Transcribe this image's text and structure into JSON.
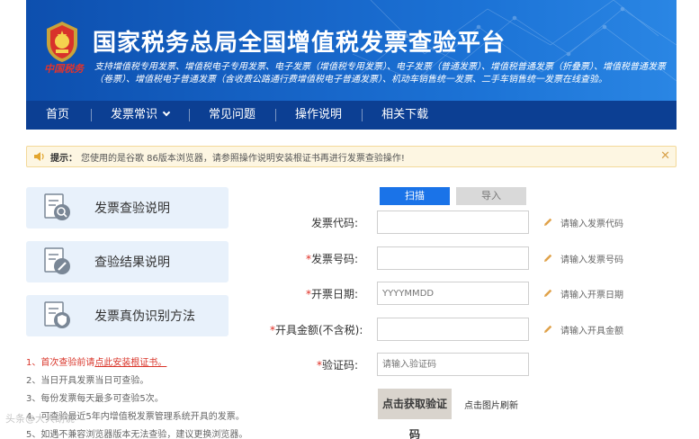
{
  "header": {
    "title": "国家税务总局全国增值税发票查验平台",
    "subtitle": "支持增值税专用发票、增值税电子专用发票、电子发票（增值税专用发票）、电子发票（普通发票）、增值税普通发票（折叠票）、增值税普通发票（卷票）、增值税电子普通发票（含收费公路通行费增值税电子普通发票）、机动车销售统一发票、二手车销售统一发票在线查验。",
    "seal_text": "中国税务"
  },
  "nav": {
    "items": [
      {
        "label": "首页"
      },
      {
        "label": "发票常识"
      },
      {
        "label": "常见问题"
      },
      {
        "label": "操作说明"
      },
      {
        "label": "相关下载"
      }
    ]
  },
  "notice": {
    "label": "提示：",
    "text": "您使用的是谷歌 86版本浏览器，请参照操作说明安装根证书再进行发票查验操作!",
    "close": "✕"
  },
  "sidebar": {
    "items": [
      {
        "label": "发票查验说明",
        "icon": "doc-search-icon"
      },
      {
        "label": "查验结果说明",
        "icon": "doc-edit-icon"
      },
      {
        "label": "发票真伪识别方法",
        "icon": "doc-shield-icon"
      }
    ]
  },
  "notes": {
    "n1_prefix": "1、首次查验前请",
    "n1_link": "点此安装根证书。",
    "n2": "2、当日开具发票当日可查验。",
    "n3": "3、每份发票每天最多可查验5次。",
    "n4": "4、可查验最近5年内增值税发票管理系统开具的发票。",
    "n5": "5、如遇不兼容浏览器版本无法查验，建议更换浏览器。"
  },
  "form": {
    "tabs": {
      "scan": "扫描",
      "import": "导入"
    },
    "fields": [
      {
        "label": "发票代码:",
        "required": false,
        "placeholder": "",
        "hint": "请输入发票代码"
      },
      {
        "label": "发票号码:",
        "required": true,
        "placeholder": "",
        "hint": "请输入发票号码"
      },
      {
        "label": "开票日期:",
        "required": true,
        "placeholder": "YYYYMMDD",
        "hint": "请输入开票日期"
      },
      {
        "label": "开具金额(不含税):",
        "required": true,
        "placeholder": "",
        "hint": "请输入开具金额"
      },
      {
        "label": "验证码:",
        "required": true,
        "placeholder": "请输入验证码",
        "hint": ""
      }
    ],
    "required_mark": "*",
    "captcha_text": "点击获取验证码",
    "refresh_text": "点击图片刷新"
  },
  "watermark": "头条@大大胡说",
  "colors": {
    "banner_blue": "#1766c9",
    "nav_blue": "#0c3f93",
    "accent_blue": "#1a73e8",
    "required_red": "#e02e24",
    "notice_bg": "#fdf6e2",
    "pencil_orange": "#e0a24a"
  }
}
